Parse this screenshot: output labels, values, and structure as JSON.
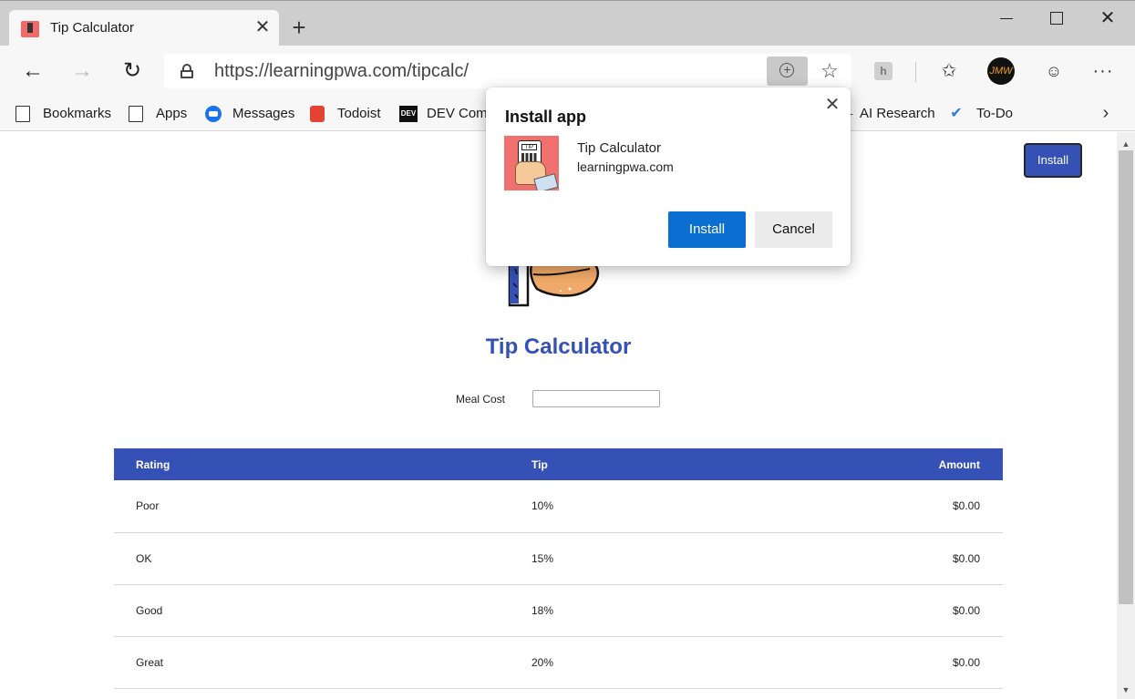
{
  "tab": {
    "title": "Tip Calculator",
    "close": "✕"
  },
  "toolbar": {
    "url": "https://learningpwa.com/tipcalc/",
    "profile_initials": "JMW"
  },
  "bookmarks": [
    {
      "label": "Bookmarks",
      "icon": "page-icon"
    },
    {
      "label": "Apps",
      "icon": "page-icon"
    },
    {
      "label": "Messages",
      "icon": "messages-icon"
    },
    {
      "label": "Todoist",
      "icon": "todoist-icon"
    },
    {
      "label": "DEV Comm",
      "icon": "dev-icon"
    },
    {
      "label": "AI Research",
      "icon": "plus-icon"
    },
    {
      "label": "To-Do",
      "icon": "check-icon"
    }
  ],
  "page": {
    "install_label": "Install",
    "title": "Tip Calculator",
    "meal_cost_label": "Meal Cost",
    "meal_cost_value": "",
    "table": {
      "headers": [
        "Rating",
        "Tip",
        "Amount"
      ],
      "rows": [
        {
          "rating": "Poor",
          "tip": "10%",
          "amount": "$0.00"
        },
        {
          "rating": "OK",
          "tip": "15%",
          "amount": "$0.00"
        },
        {
          "rating": "Good",
          "tip": "18%",
          "amount": "$0.00"
        },
        {
          "rating": "Great",
          "tip": "20%",
          "amount": "$0.00"
        }
      ]
    }
  },
  "popup": {
    "title": "Install app",
    "app_name": "Tip Calculator",
    "app_domain": "learningpwa.com",
    "icon_text": "TIP",
    "install_label": "Install",
    "cancel_label": "Cancel"
  },
  "colors": {
    "brand_blue": "#3551b5",
    "primary_button": "#0a6fd1",
    "app_icon_bg": "#f07070"
  }
}
